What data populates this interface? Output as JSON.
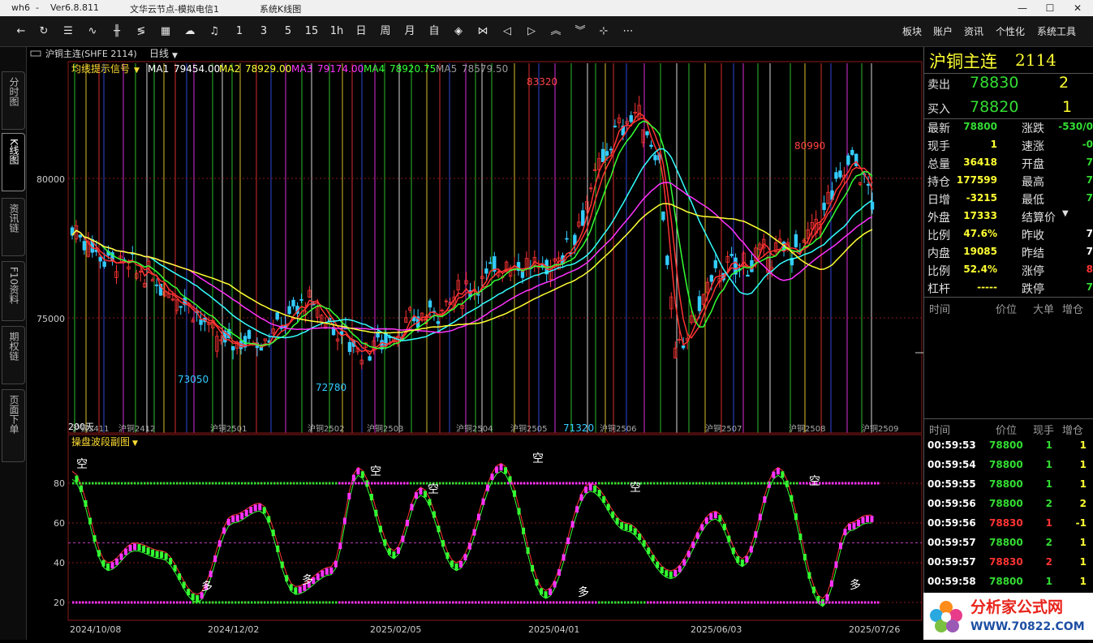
{
  "titlebar": {
    "app": "wh6",
    "sep": "-",
    "version": "Ver6.8.811",
    "server": "文华云节点-模拟电信1",
    "window": "系统K线图",
    "min": "—",
    "max": "☐",
    "close": "✕"
  },
  "toolbar": {
    "periods": [
      "1",
      "3",
      "5",
      "15",
      "1h",
      "日",
      "周",
      "月",
      "自"
    ],
    "right_menu": [
      "板块",
      "账户",
      "资讯",
      "个性化",
      "系统工具"
    ],
    "icons": [
      "back-icon",
      "refresh-icon",
      "list-icon",
      "line-chart-icon",
      "kline-icon",
      "tick-icon",
      "table-icon",
      "cloud-icon",
      "bell-icon",
      "split-icon",
      "hourglass-icon",
      "arrow-left-icon",
      "arrow-right-icon",
      "arrow-up-icon",
      "arrow-down-icon",
      "crosshair-icon",
      "more-icon"
    ]
  },
  "sidebar": {
    "tabs": [
      "分时图",
      "K线图",
      "资讯链",
      "F10资料",
      "期权链",
      "页面下单"
    ],
    "active": 1
  },
  "chart": {
    "symbol_label": "沪铜主连(SHFE 2114)",
    "period_label": "日线",
    "indicator_label": "均线提示信号",
    "ma": [
      {
        "name": "MA1",
        "value": "79454.00",
        "color": "#ffffff"
      },
      {
        "name": "MA2",
        "value": "78929.00",
        "color": "#ffff33"
      },
      {
        "name": "MA3",
        "value": "79174.00",
        "color": "#ff33ff"
      },
      {
        "name": "MA4",
        "value": "78920.75",
        "color": "#33ff33"
      },
      {
        "name": "MA5",
        "value": "78579.50",
        "color": "#999999"
      }
    ],
    "y_ticks": [
      "80000",
      "75000"
    ],
    "annotations": [
      "83320",
      "80990",
      "73050",
      "72780",
      "71320",
      "200天"
    ],
    "contracts": [
      "沪铜2411",
      "沪铜2412",
      "沪铜2501",
      "沪铜2502",
      "沪铜2503",
      "沪铜2504",
      "沪铜2505",
      "沪铜2506",
      "沪铜2507",
      "沪铜2508",
      "沪铜2509"
    ],
    "sub_label": "操盘波段副图",
    "sub_ticks": [
      "80",
      "60",
      "40",
      "20"
    ],
    "signals": [
      "空",
      "多",
      "多",
      "空",
      "空",
      "空",
      "多",
      "空",
      "空",
      "多"
    ],
    "dates": [
      "2024/10/08",
      "2024/12/02",
      "2025/02/05",
      "2025/04/01",
      "2025/06/03",
      "2025/07/26"
    ]
  },
  "quote": {
    "name": "沪铜主连",
    "code": "2114",
    "ask_label": "卖出",
    "ask_price": "78830",
    "ask_vol": "2",
    "bid_label": "买入",
    "bid_price": "78820",
    "bid_vol": "1",
    "left_rows": [
      {
        "label": "最新",
        "value": "78800",
        "cls": "g"
      },
      {
        "label": "现手",
        "value": "1",
        "cls": "y"
      },
      {
        "label": "总量",
        "value": "36418",
        "cls": "y"
      },
      {
        "label": "持仓",
        "value": "177599",
        "cls": "y"
      },
      {
        "label": "日增",
        "value": "-3215",
        "cls": "y"
      },
      {
        "label": "外盘",
        "value": "17333",
        "cls": "y"
      },
      {
        "label": "比例",
        "value": "47.6%",
        "cls": "y"
      },
      {
        "label": "内盘",
        "value": "19085",
        "cls": "y"
      },
      {
        "label": "比例",
        "value": "52.4%",
        "cls": "y"
      },
      {
        "label": "杠杆",
        "value": "-----",
        "cls": "y"
      }
    ],
    "right_rows": [
      {
        "label": "涨跌",
        "value": "-530/0",
        "cls": "g"
      },
      {
        "label": "速涨",
        "value": "-0",
        "cls": "g"
      },
      {
        "label": "开盘",
        "value": "7",
        "cls": "g"
      },
      {
        "label": "最高",
        "value": "7",
        "cls": "g"
      },
      {
        "label": "最低",
        "value": "7",
        "cls": "g"
      },
      {
        "label": "结算价",
        "value": "",
        "cls": "g"
      },
      {
        "label": "昨收",
        "value": "7",
        "cls": "w"
      },
      {
        "label": "昨结",
        "value": "7",
        "cls": "w"
      },
      {
        "label": "涨停",
        "value": "8",
        "cls": "r"
      },
      {
        "label": "跌停",
        "value": "7",
        "cls": "g"
      }
    ],
    "big_header": [
      "时间",
      "价位",
      "大单",
      "增仓"
    ],
    "tick_header": [
      "时间",
      "价位",
      "现手",
      "增仓"
    ],
    "ticks": [
      {
        "time": "00:59:53",
        "price": "78800",
        "vol": "1",
        "oi": "1",
        "pc": "g",
        "vc": "g"
      },
      {
        "time": "00:59:54",
        "price": "78800",
        "vol": "1",
        "oi": "1",
        "pc": "g",
        "vc": "g"
      },
      {
        "time": "00:59:55",
        "price": "78800",
        "vol": "1",
        "oi": "1",
        "pc": "g",
        "vc": "g"
      },
      {
        "time": "00:59:56",
        "price": "78800",
        "vol": "2",
        "oi": "2",
        "pc": "g",
        "vc": "g"
      },
      {
        "time": "00:59:56",
        "price": "78830",
        "vol": "1",
        "oi": "-1",
        "pc": "r",
        "vc": "r"
      },
      {
        "time": "00:59:57",
        "price": "78800",
        "vol": "2",
        "oi": "1",
        "pc": "g",
        "vc": "g"
      },
      {
        "time": "00:59:57",
        "price": "78830",
        "vol": "2",
        "oi": "1",
        "pc": "r",
        "vc": "r"
      },
      {
        "time": "00:59:58",
        "price": "78800",
        "vol": "1",
        "oi": "1",
        "pc": "g",
        "vc": "g"
      }
    ]
  },
  "logo": {
    "cn": "分析家公式网",
    "url": "WWW.70822.COM"
  }
}
